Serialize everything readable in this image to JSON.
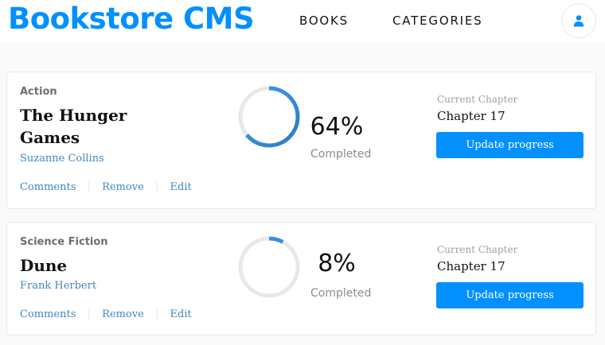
{
  "header": {
    "brand": "Bookstore CMS",
    "nav": [
      {
        "label": "BOOKS"
      },
      {
        "label": "CATEGORIES"
      }
    ],
    "user_icon": "user-icon"
  },
  "books": [
    {
      "genre": "Action",
      "title": "The Hunger Games",
      "author": "Suzanne Collins",
      "actions": {
        "comments": "Comments",
        "separator": "|",
        "remove": "Remove",
        "edit": "Edit"
      },
      "progress": {
        "percent_value": 64,
        "percent_text": "64%",
        "completed_label": "Completed"
      },
      "chapter": {
        "label": "Current Chapter",
        "value": "Chapter 17"
      },
      "update_label": "Update progress"
    },
    {
      "genre": "Science Fiction",
      "title": "Dune",
      "author": "Frank Herbert",
      "actions": {
        "comments": "Comments",
        "separator": "|",
        "remove": "Remove",
        "edit": "Edit"
      },
      "progress": {
        "percent_value": 8,
        "percent_text": "8%",
        "completed_label": "Completed"
      },
      "chapter": {
        "label": "Current Chapter",
        "value": "Chapter 17"
      },
      "update_label": "Update progress"
    }
  ],
  "colors": {
    "accent": "#0290ff",
    "progress_start": "#307bbe",
    "progress_end": "#379cf6",
    "track": "#e8e8e8",
    "link": "#4386bf"
  }
}
